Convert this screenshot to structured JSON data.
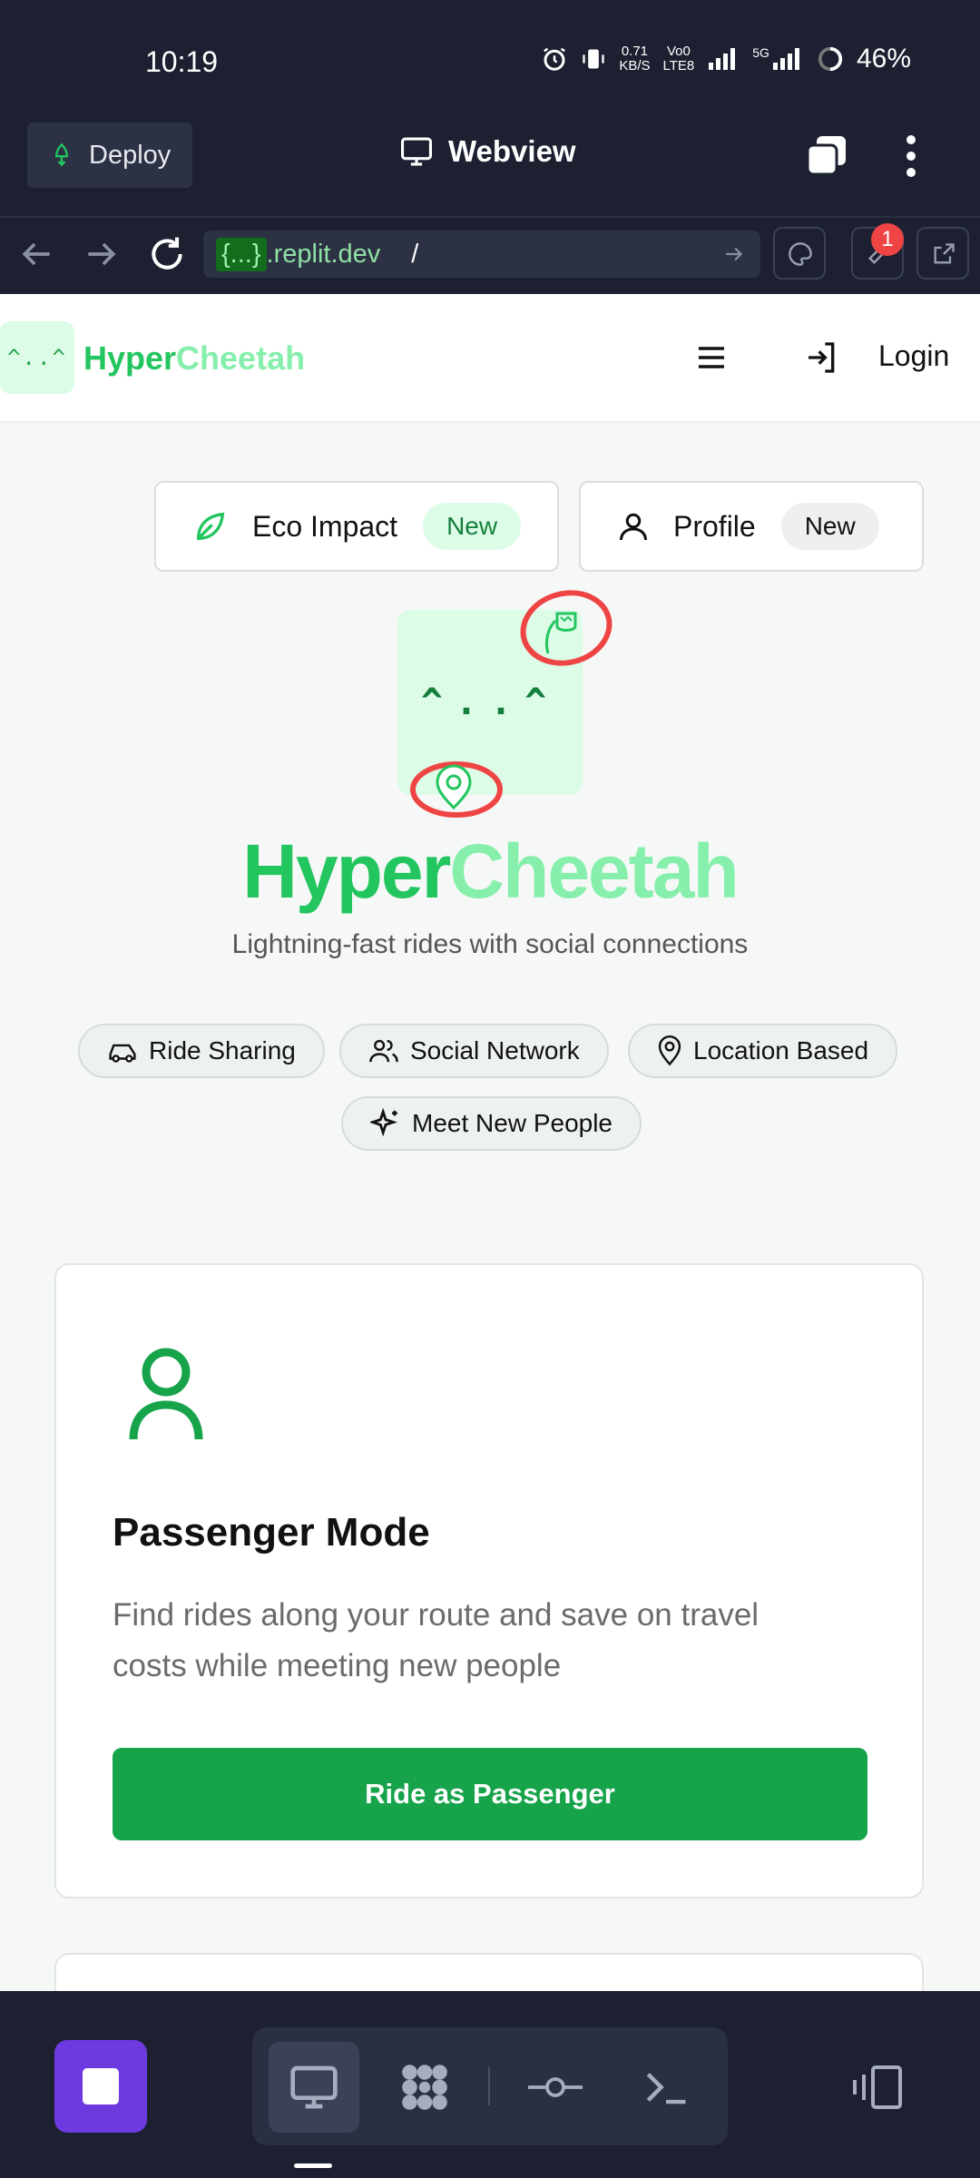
{
  "status_bar": {
    "time": "10:19",
    "net_speed_top": "0.71",
    "net_speed_bottom": "KB/S",
    "volte_top": "Vo0",
    "volte_bottom": "LTE8",
    "network": "5G",
    "battery": "46%"
  },
  "replit_bar": {
    "deploy_label": "Deploy",
    "webview_label": "Webview"
  },
  "url_bar": {
    "host_highlight": "{...}",
    "host_rest": ".replit.dev",
    "path": "/",
    "devtools_badge": "1"
  },
  "site_header": {
    "logo_face": "^..^",
    "brand_part1": "Hyper",
    "brand_part2": "Cheetah",
    "login_label": "Login"
  },
  "feature_pills": [
    {
      "label": "Eco Impact",
      "badge": "New"
    },
    {
      "label": "Profile",
      "badge": "New"
    }
  ],
  "hero": {
    "mascot_face": "^..^",
    "title_part1": "Hyper",
    "title_part2": "Cheetah",
    "tagline": "Lightning-fast rides with social connections"
  },
  "chips": [
    {
      "label": "Ride Sharing",
      "icon": "car-icon"
    },
    {
      "label": "Social Network",
      "icon": "users-icon"
    },
    {
      "label": "Location Based",
      "icon": "map-pin-icon"
    },
    {
      "label": "Meet New People",
      "icon": "sparkles-icon"
    }
  ],
  "passenger_card": {
    "icon": "user-icon",
    "title": "Passenger Mode",
    "description": "Find rides along your route and save on travel costs while meeting new people",
    "button_label": "Ride as Passenger"
  },
  "colors": {
    "primary_green": "#16a34a",
    "brand_green": "#22c55e",
    "brand_light_green": "#86efac",
    "replit_bg": "#1c2030",
    "accent_purple": "#6d3ae0",
    "alert_red": "#ef4444"
  }
}
